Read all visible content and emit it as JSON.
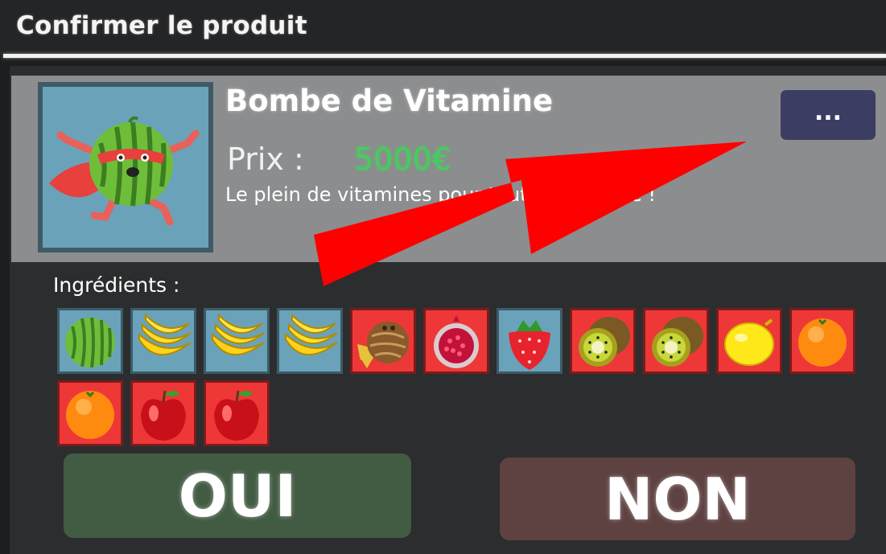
{
  "dialog": {
    "title": "Confirmer le produit"
  },
  "product": {
    "name": "Bombe de Vitamine",
    "price_label": "Prix :",
    "price_value": "5000€",
    "description": "Le plein de vitamines pour toute la journée !",
    "image_icon": "watermelon-superhero-icon",
    "more_label": "..."
  },
  "ingredients": {
    "label": "Ingrédients :",
    "items": [
      {
        "name": "watermelon",
        "icon": "watermelon-icon",
        "tile": "blue"
      },
      {
        "name": "banana",
        "icon": "banana-icon",
        "tile": "blue"
      },
      {
        "name": "banana",
        "icon": "banana-icon",
        "tile": "blue"
      },
      {
        "name": "banana",
        "icon": "banana-icon",
        "tile": "blue"
      },
      {
        "name": "coconut",
        "icon": "coconut-icon",
        "tile": "red"
      },
      {
        "name": "pomegranate",
        "icon": "pomegranate-icon",
        "tile": "red"
      },
      {
        "name": "strawberry",
        "icon": "strawberry-icon",
        "tile": "blue"
      },
      {
        "name": "kiwi",
        "icon": "kiwi-icon",
        "tile": "red"
      },
      {
        "name": "kiwi",
        "icon": "kiwi-icon",
        "tile": "red"
      },
      {
        "name": "lemon",
        "icon": "lemon-icon",
        "tile": "red"
      },
      {
        "name": "orange",
        "icon": "orange-icon",
        "tile": "red"
      },
      {
        "name": "orange",
        "icon": "orange-icon",
        "tile": "red"
      },
      {
        "name": "apple",
        "icon": "apple-icon",
        "tile": "red"
      },
      {
        "name": "apple",
        "icon": "apple-icon",
        "tile": "red"
      }
    ]
  },
  "actions": {
    "yes_label": "OUI",
    "no_label": "NON"
  },
  "colors": {
    "price": "#41d05a",
    "yes_button": "#425b43",
    "no_button": "#5e4141",
    "tile_blue": "#6aa3b9",
    "tile_red": "#ee3838",
    "arrow": "#ff0000"
  }
}
